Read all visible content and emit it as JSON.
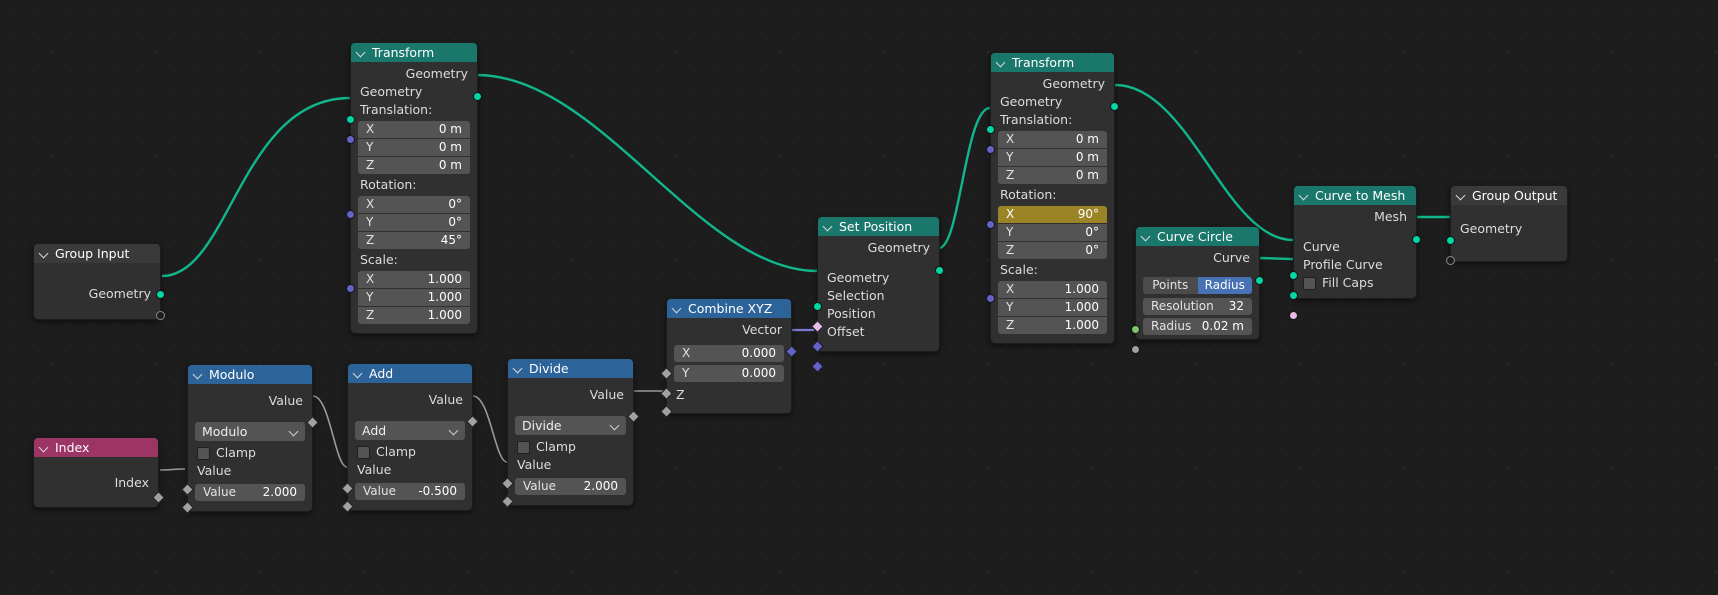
{
  "editor": {
    "name": "Blender Geometry Node Editor",
    "background": "#1d1d1d"
  },
  "colors": {
    "geometry_header": "#19786b",
    "converter_header": "#2c6399",
    "group_header": "#3a3a3a",
    "input_header": "#9c3464",
    "geometry_socket": "#00d6a3",
    "vector_socket": "#6363c7",
    "value_socket": "#a1a1a1",
    "animated_field": "#9a8426",
    "active_toggle": "#4772b3"
  },
  "nodes": [
    {
      "id": "group-input",
      "title": "Group Input",
      "header_style": "input",
      "outputs": [
        {
          "label": "Geometry",
          "type": "geometry"
        },
        {
          "label": "",
          "type": "hollow"
        }
      ]
    },
    {
      "id": "transform-1",
      "title": "Transform",
      "header_style": "geometry",
      "outputs": [
        {
          "label": "Geometry",
          "type": "geometry"
        }
      ],
      "inputs": [
        {
          "label": "Geometry",
          "type": "geometry"
        }
      ],
      "groups": [
        {
          "label": "Translation:",
          "socket": "vector",
          "fields": [
            {
              "name": "X",
              "value": "0 m"
            },
            {
              "name": "Y",
              "value": "0 m"
            },
            {
              "name": "Z",
              "value": "0 m"
            }
          ]
        },
        {
          "label": "Rotation:",
          "socket": "vector",
          "fields": [
            {
              "name": "X",
              "value": "0°"
            },
            {
              "name": "Y",
              "value": "0°"
            },
            {
              "name": "Z",
              "value": "45°"
            }
          ]
        },
        {
          "label": "Scale:",
          "socket": "vector",
          "fields": [
            {
              "name": "X",
              "value": "1.000"
            },
            {
              "name": "Y",
              "value": "1.000"
            },
            {
              "name": "Z",
              "value": "1.000"
            }
          ]
        }
      ]
    },
    {
      "id": "transform-2",
      "title": "Transform",
      "header_style": "geometry",
      "outputs": [
        {
          "label": "Geometry",
          "type": "geometry"
        }
      ],
      "inputs": [
        {
          "label": "Geometry",
          "type": "geometry"
        }
      ],
      "groups": [
        {
          "label": "Translation:",
          "socket": "vector",
          "fields": [
            {
              "name": "X",
              "value": "0 m"
            },
            {
              "name": "Y",
              "value": "0 m"
            },
            {
              "name": "Z",
              "value": "0 m"
            }
          ]
        },
        {
          "label": "Rotation:",
          "socket": "vector",
          "fields": [
            {
              "name": "X",
              "value": "90°",
              "animated": true
            },
            {
              "name": "Y",
              "value": "0°"
            },
            {
              "name": "Z",
              "value": "0°"
            }
          ]
        },
        {
          "label": "Scale:",
          "socket": "vector",
          "fields": [
            {
              "name": "X",
              "value": "1.000"
            },
            {
              "name": "Y",
              "value": "1.000"
            },
            {
              "name": "Z",
              "value": "1.000"
            }
          ]
        }
      ]
    },
    {
      "id": "set-position",
      "title": "Set Position",
      "header_style": "geometry",
      "outputs": [
        {
          "label": "Geometry",
          "type": "geometry"
        }
      ],
      "inputs": [
        {
          "label": "Geometry",
          "type": "geometry"
        },
        {
          "label": "Selection",
          "type": "pink-diamond"
        },
        {
          "label": "Position",
          "type": "vector-diamond"
        },
        {
          "label": "Offset",
          "type": "vector-diamond"
        }
      ]
    },
    {
      "id": "combine-xyz",
      "title": "Combine XYZ",
      "header_style": "converter",
      "outputs": [
        {
          "label": "Vector",
          "type": "vector-diamond"
        }
      ],
      "fields": [
        {
          "name": "X",
          "value": "0.000"
        },
        {
          "name": "Y",
          "value": "0.000"
        }
      ],
      "inputs": [
        {
          "label": "Z",
          "type": "grey-diamond"
        }
      ]
    },
    {
      "id": "curve-circle",
      "title": "Curve Circle",
      "header_style": "geometry",
      "outputs": [
        {
          "label": "Curve",
          "type": "geometry"
        }
      ],
      "toggle": {
        "options": [
          "Points",
          "Radius"
        ],
        "selected": "Radius"
      },
      "fields": [
        {
          "name": "Resolution",
          "value": "32",
          "socket": "green"
        },
        {
          "name": "Radius",
          "value": "0.02 m",
          "socket": "grey"
        }
      ]
    },
    {
      "id": "curve-to-mesh",
      "title": "Curve to Mesh",
      "header_style": "geometry",
      "outputs": [
        {
          "label": "Mesh",
          "type": "geometry"
        }
      ],
      "inputs": [
        {
          "label": "Curve",
          "type": "geometry"
        },
        {
          "label": "Profile Curve",
          "type": "geometry"
        }
      ],
      "checkbox": {
        "label": "Fill Caps",
        "checked": false,
        "socket": "pink"
      }
    },
    {
      "id": "group-output",
      "title": "Group Output",
      "header_style": "group",
      "inputs": [
        {
          "label": "Geometry",
          "type": "geometry"
        },
        {
          "label": "",
          "type": "hollow"
        }
      ]
    },
    {
      "id": "index",
      "title": "Index",
      "header_style": "input",
      "outputs": [
        {
          "label": "Index",
          "type": "green-small"
        }
      ]
    },
    {
      "id": "modulo",
      "title": "Modulo",
      "header_style": "converter",
      "outputs": [
        {
          "label": "Value",
          "type": "grey-diamond"
        }
      ],
      "operation": "Modulo",
      "clamp": {
        "label": "Clamp",
        "checked": false
      },
      "inputs": [
        {
          "label": "Value",
          "type": "grey-diamond"
        }
      ],
      "fields": [
        {
          "name": "Value",
          "value": "2.000"
        }
      ]
    },
    {
      "id": "add",
      "title": "Add",
      "header_style": "converter",
      "outputs": [
        {
          "label": "Value",
          "type": "grey-diamond"
        }
      ],
      "operation": "Add",
      "clamp": {
        "label": "Clamp",
        "checked": false
      },
      "inputs": [
        {
          "label": "Value",
          "type": "grey-diamond"
        }
      ],
      "fields": [
        {
          "name": "Value",
          "value": "-0.500"
        }
      ]
    },
    {
      "id": "divide",
      "title": "Divide",
      "header_style": "converter",
      "outputs": [
        {
          "label": "Value",
          "type": "grey-diamond"
        }
      ],
      "operation": "Divide",
      "clamp": {
        "label": "Clamp",
        "checked": false
      },
      "inputs": [
        {
          "label": "Value",
          "type": "grey-diamond"
        }
      ],
      "fields": [
        {
          "name": "Value",
          "value": "2.000"
        }
      ]
    }
  ]
}
